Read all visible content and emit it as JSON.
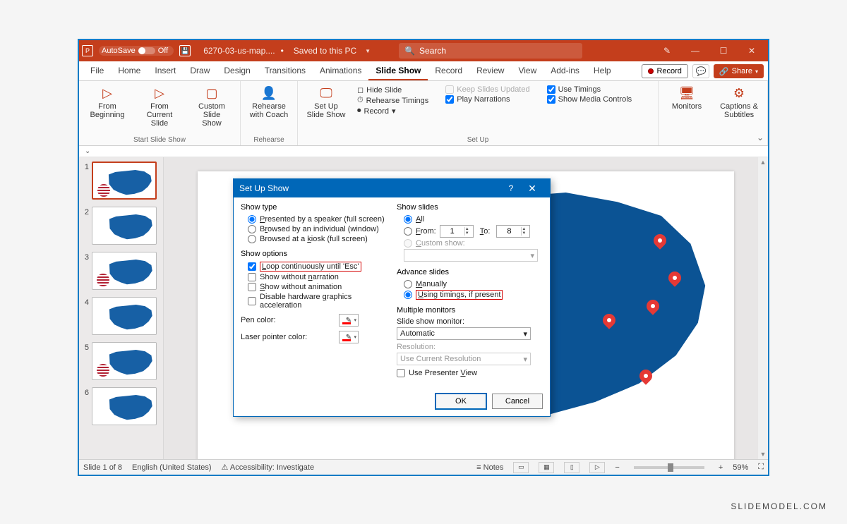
{
  "titlebar": {
    "autosave_label": "AutoSave",
    "autosave_state": "Off",
    "filename": "6270-03-us-map....",
    "saved_status": "Saved to this PC",
    "search_placeholder": "Search"
  },
  "tabs": {
    "items": [
      "File",
      "Home",
      "Insert",
      "Draw",
      "Design",
      "Transitions",
      "Animations",
      "Slide Show",
      "Record",
      "Review",
      "View",
      "Add-ins",
      "Help"
    ],
    "active_index": 7,
    "record_btn": "Record",
    "share_btn": "Share"
  },
  "ribbon": {
    "groups": [
      {
        "name": "Start Slide Show",
        "buttons": [
          {
            "label": "From\nBeginning"
          },
          {
            "label": "From\nCurrent Slide"
          },
          {
            "label": "Custom Slide\nShow"
          }
        ]
      },
      {
        "name": "Rehearse",
        "buttons": [
          {
            "label": "Rehearse\nwith Coach"
          }
        ]
      },
      {
        "name": "Set Up",
        "buttons": [
          {
            "label": "Set Up\nSlide Show"
          }
        ],
        "small_left": [
          "Hide Slide",
          "Rehearse Timings",
          "Record"
        ],
        "checks": [
          {
            "label": "Keep Slides Updated",
            "checked": false,
            "disabled": true
          },
          {
            "label": "Play Narrations",
            "checked": true
          },
          {
            "label": "Use Timings",
            "checked": true
          },
          {
            "label": "Show Media Controls",
            "checked": true
          }
        ]
      },
      {
        "name": "",
        "buttons": [
          {
            "label": "Monitors"
          },
          {
            "label": "Captions &\nSubtitles"
          }
        ]
      }
    ]
  },
  "thumbs": {
    "count": 6
  },
  "dialog": {
    "title": "Set Up Show",
    "show_type": {
      "title": "Show type",
      "options": [
        "Presented by a speaker (full screen)",
        "Browsed by an individual (window)",
        "Browsed at a kiosk (full screen)"
      ],
      "selected": 0
    },
    "show_options": {
      "title": "Show options",
      "checks": [
        {
          "label": "Loop continuously until 'Esc'",
          "checked": true,
          "highlight": true
        },
        {
          "label": "Show without narration",
          "checked": false
        },
        {
          "label": "Show without animation",
          "checked": false
        },
        {
          "label": "Disable hardware graphics acceleration",
          "checked": false
        }
      ],
      "pen_label": "Pen color:",
      "laser_label": "Laser pointer color:"
    },
    "show_slides": {
      "title": "Show slides",
      "all": "All",
      "from": "From:",
      "to": "To:",
      "from_val": "1",
      "to_val": "8",
      "custom": "Custom show:",
      "selected": 0
    },
    "advance": {
      "title": "Advance slides",
      "options": [
        "Manually",
        "Using timings, if present"
      ],
      "selected": 1
    },
    "monitors": {
      "title": "Multiple monitors",
      "monitor_label": "Slide show monitor:",
      "monitor_val": "Automatic",
      "res_label": "Resolution:",
      "res_val": "Use Current Resolution",
      "presenter": "Use Presenter View"
    },
    "ok": "OK",
    "cancel": "Cancel"
  },
  "status": {
    "slide": "Slide 1 of 8",
    "lang": "English (United States)",
    "access": "Accessibility: Investigate",
    "notes": "Notes",
    "zoom": "59%"
  },
  "watermark": "SLIDEMODEL.COM"
}
